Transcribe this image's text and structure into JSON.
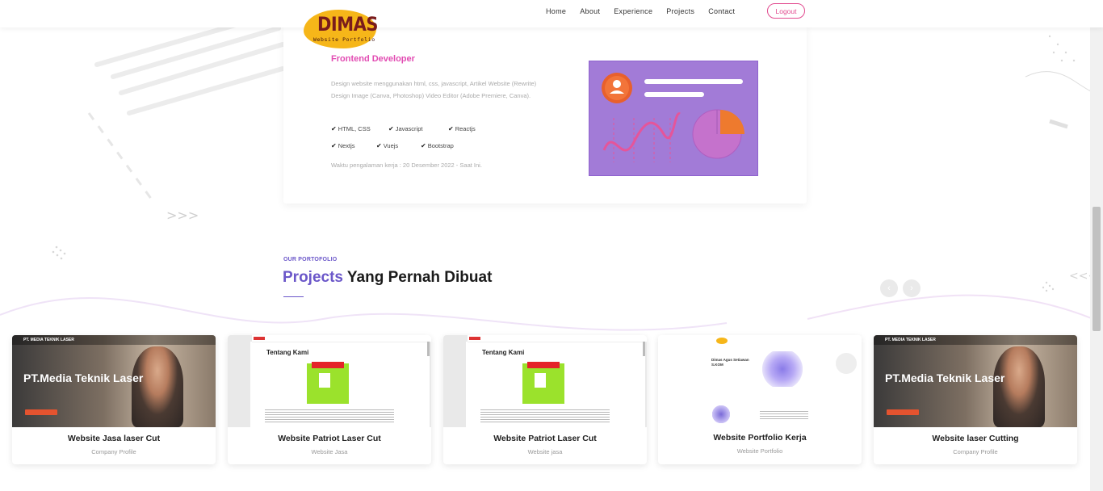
{
  "header": {
    "logo_text": "DIMAS",
    "logo_sub": "Website Portfolio",
    "nav": [
      "Home",
      "About",
      "Experience",
      "Projects",
      "Contact"
    ],
    "logout_label": "Logout"
  },
  "experience": {
    "title": "Frontend Developer",
    "description": "Design website menggunakan html, css, javascript, Artikel Website (Rewrite) Design Image (Canva, Photoshop) Video Editor (Adobe Premiere, Canva).",
    "skills": [
      "HTML, CSS",
      "Javascript",
      "Reactjs",
      "Nextjs",
      "Vuejs",
      "Bootstrap"
    ],
    "time": "Waktu pengalaman kerja : 20 Desember 2022 - Saat Ini."
  },
  "portfolio": {
    "tag": "OUR PORTOFOLIO",
    "title_accent": "Projects",
    "title_rest": " Yang Pernah Dibuat",
    "prev_icon": "chevron-left-icon",
    "next_icon": "chevron-right-icon",
    "cards": [
      {
        "title": "Website Jasa laser Cut",
        "subtitle": "Company Profile",
        "thumb": "laser",
        "thumb_brand": "PT. MEDIA TEKNIK LASER",
        "thumb_hero": "PT.Media Teknik Laser"
      },
      {
        "title": "Website Patriot Laser Cut",
        "subtitle": "Website Jasa",
        "thumb": "patriot",
        "thumb_heading": "Tentang Kami"
      },
      {
        "title": "Website Patriot Laser Cut",
        "subtitle": "Website jasa",
        "thumb": "patriot",
        "thumb_heading": "Tentang Kami"
      },
      {
        "title": "Website Portfolio Kerja",
        "subtitle": "Website Portfolio",
        "thumb": "portfolio",
        "thumb_heading": "Dimas Agus Setiawan S.KOM"
      },
      {
        "title": "Website laser Cutting",
        "subtitle": "Company Profile",
        "thumb": "laser",
        "thumb_brand": "PT. MEDIA TEKNIK LASER",
        "thumb_hero": "PT.Media Teknik Laser"
      }
    ]
  },
  "colors": {
    "accent_purple": "#6b57c9",
    "accent_pink": "#e24bb2",
    "logo_yellow": "#f6b619",
    "illustration_bg": "#a27bd7"
  }
}
